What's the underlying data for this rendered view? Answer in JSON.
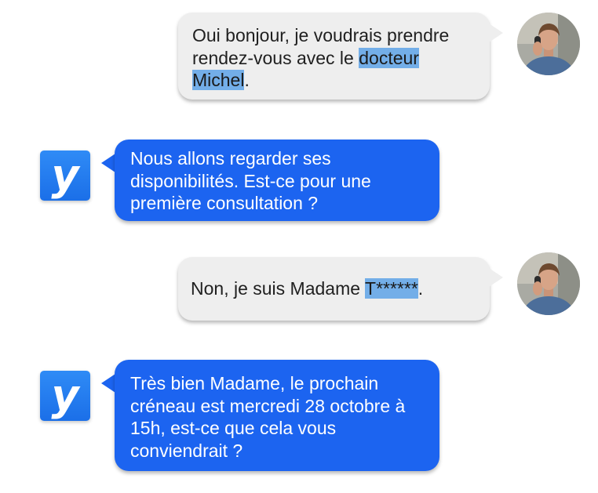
{
  "conversation": {
    "messages": [
      {
        "sender": "user",
        "text_before": "Oui bonjour, je voudrais prendre rendez-vous avec le ",
        "highlighted": "docteur Michel",
        "text_after": "."
      },
      {
        "sender": "bot",
        "text": "Nous allons regarder ses disponibilités. Est-ce pour une première consultation ?"
      },
      {
        "sender": "user",
        "text_before": "Non, je suis Madame ",
        "highlighted": "T******",
        "text_after": "."
      },
      {
        "sender": "bot",
        "text": "Très bien Madame, le prochain créneau est mercredi 28 octobre à 15h, est-ce que cela vous conviendrait ?"
      }
    ],
    "bot_logo_letter": "y",
    "user_avatar_icon": "user-photo-avatar-icon"
  },
  "colors": {
    "bot_bubble": "#1c64f0",
    "user_bubble": "#eeeeee",
    "highlight": "#73aee8",
    "bot_logo": "#2f8bf6"
  }
}
